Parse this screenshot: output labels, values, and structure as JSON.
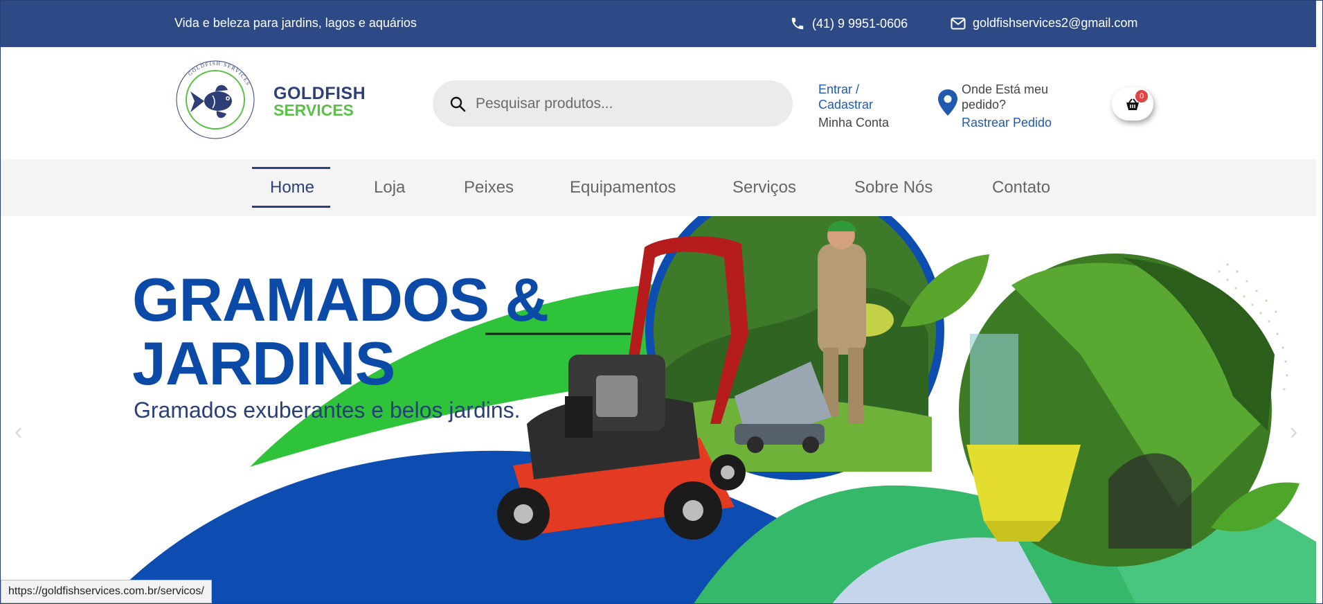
{
  "topbar": {
    "tagline": "Vida e beleza para jardins, lagos e aquários",
    "phone": "(41) 9 9951-0606",
    "email": "goldfishservices2@gmail.com"
  },
  "header": {
    "brand_line1": "GOLDFISH",
    "brand_line2": "SERVICES",
    "logo_ring_text": "GOLDFISH SERVICES",
    "search_placeholder": "Pesquisar produtos...",
    "login_label": "Entrar / Cadastrar",
    "account_label": "Minha Conta",
    "track_question": "Onde Está meu pedido?",
    "track_link": "Rastrear Pedido",
    "cart_count": "0"
  },
  "nav": {
    "items": [
      {
        "label": "Home",
        "active": true
      },
      {
        "label": "Loja"
      },
      {
        "label": "Peixes"
      },
      {
        "label": "Equipamentos"
      },
      {
        "label": "Serviços"
      },
      {
        "label": "Sobre Nós"
      },
      {
        "label": "Contato"
      }
    ]
  },
  "hero": {
    "title_line1": "GRAMADOS &",
    "title_line2": "JARDINS",
    "subtitle": "Gramados exuberantes e belos jardins.",
    "prev_icon": "chevron-left-icon",
    "next_icon": "chevron-right-icon"
  },
  "status_bar": {
    "url": "https://goldfishservices.com.br/servicos/"
  },
  "colors": {
    "topbar": "#2e4a86",
    "brand_blue": "#2e3f77",
    "brand_green": "#5ac048",
    "hero_blue": "#0c4aa8",
    "hero_green": "#2ec33a"
  }
}
